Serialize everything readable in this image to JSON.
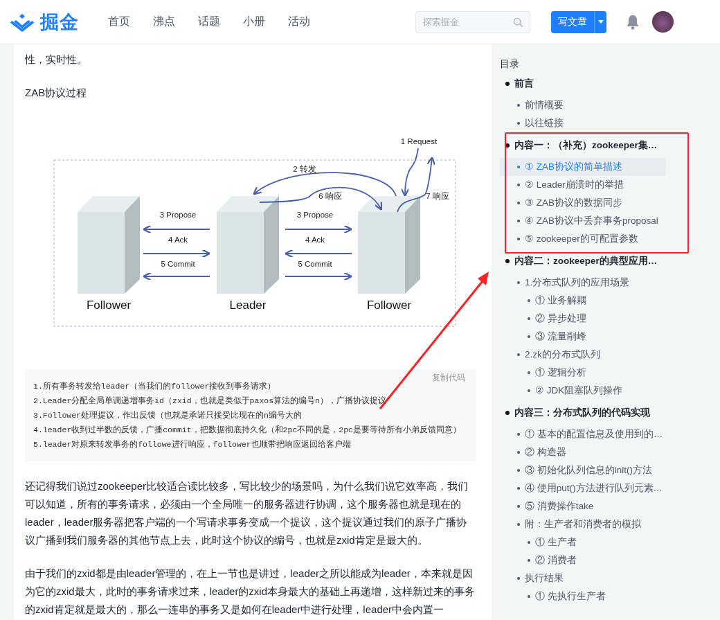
{
  "header": {
    "logo": "掘金",
    "nav": [
      {
        "label": "首页"
      },
      {
        "label": "沸点"
      },
      {
        "label": "话题"
      },
      {
        "label": "小册"
      },
      {
        "label": "活动"
      }
    ],
    "search": {
      "placeholder": "探索掘金"
    },
    "write_button": "写文章"
  },
  "article": {
    "intro_tail": "性，实时性。",
    "heading": "ZAB协议过程",
    "diagram": {
      "nodes": [
        {
          "label": "Follower"
        },
        {
          "label": "Leader"
        },
        {
          "label": "Follower"
        }
      ],
      "messages": [
        {
          "label": "1 Request"
        },
        {
          "label": "2 转发"
        },
        {
          "label": "6 响应"
        },
        {
          "label": "7 响应"
        },
        {
          "label": "3 Propose"
        },
        {
          "label": "4 Ack"
        },
        {
          "label": "5 Commit"
        },
        {
          "label": "3 Propose"
        },
        {
          "label": "4 Ack"
        },
        {
          "label": "5 Commit"
        }
      ]
    },
    "code": {
      "copy_label": "复制代码",
      "lines": [
        "1.所有事务转发给leader（当我们的follower接收到事务请求）",
        "2.Leader分配全局单调递增事务id（zxid，也就是类似于paxos算法的编号n），广播协议提议",
        "3.Follower处理提议，作出反馈（也就是承诺只接受比现在的n编号大的",
        "4.leader收到过半数的反馈，广播commit，把数据彻底持久化（和2pc不同的是，2pc是要等待所有小弟反馈同意）",
        "5.leader对原来转发事务的followe进行响应，follower也顺带把响应返回给客户端"
      ]
    },
    "paragraphs": [
      "还记得我们说过zookeeper比较适合读比较多，写比较少的场景吗，为什么我们说它效率高，我们可以知道，所有的事务请求，必须由一个全局唯一的服务器进行协调，这个服务器也就是现在的leader，leader服务器把客户端的一个写请求事务变成一个提议，这个提议通过我们的原子广播协议广播到我们服务器的其他节点上去，此时这个协议的编号，也就是zxid肯定是最大的。",
      "由于我们的zxid都是由leader管理的，在上一节也是讲过，leader之所以能成为leader，本来就是因为它的zxid最大，此时的事务请求过来，leader的zxid本身最大的基础上再递增，这样新过来的事务的zxid肯定就是最大的，那么一连串的事务又是如何在leader中进行处理，leader中会内置一"
    ]
  },
  "toc": {
    "title": "目录",
    "items": [
      {
        "text": "前言",
        "selected": false,
        "children": [
          {
            "text": "前情概要",
            "selected": false
          },
          {
            "text": "以往链接",
            "selected": false
          }
        ]
      },
      {
        "text": "内容一：（补充）zookeeper集…",
        "selected": false,
        "children": [
          {
            "text": "① ZAB协议的简单描述",
            "selected": true
          },
          {
            "text": "② Leader崩溃时的举措",
            "selected": false
          },
          {
            "text": "③ ZAB协议的数据同步",
            "selected": false
          },
          {
            "text": "④ ZAB协议中丢弃事务proposal",
            "selected": false
          },
          {
            "text": "⑤ zookeeper的可配置参数",
            "selected": false
          }
        ]
      },
      {
        "text": "内容二：zookeeper的典型应用…",
        "selected": false,
        "children": [
          {
            "text": "1.分布式队列的应用场景",
            "selected": false,
            "children": [
              {
                "text": "① 业务解耦",
                "selected": false
              },
              {
                "text": "② 异步处理",
                "selected": false
              },
              {
                "text": "③ 流量削峰",
                "selected": false
              }
            ]
          },
          {
            "text": "2.zk的分布式队列",
            "selected": false,
            "children": [
              {
                "text": "① 逻辑分析",
                "selected": false
              },
              {
                "text": "② JDK阻塞队列操作",
                "selected": false
              }
            ]
          }
        ]
      },
      {
        "text": "内容三：分布式队列的代码实现",
        "selected": false,
        "children": [
          {
            "text": "① 基本的配置信息及使用到的…",
            "selected": false
          },
          {
            "text": "② 构造器",
            "selected": false
          },
          {
            "text": "③ 初始化队列信息的init()方法",
            "selected": false
          },
          {
            "text": "④ 使用put()方法进行队列元素…",
            "selected": false
          },
          {
            "text": "⑤ 消费操作take",
            "selected": false
          },
          {
            "text": "附：生产者和消费者的模拟",
            "selected": false,
            "children": [
              {
                "text": "① 生产者",
                "selected": false
              },
              {
                "text": "② 消费者",
                "selected": false
              }
            ]
          },
          {
            "text": "执行结果",
            "selected": false,
            "children": [
              {
                "text": "① 先执行生产者",
                "selected": false
              }
            ]
          }
        ]
      }
    ]
  }
}
